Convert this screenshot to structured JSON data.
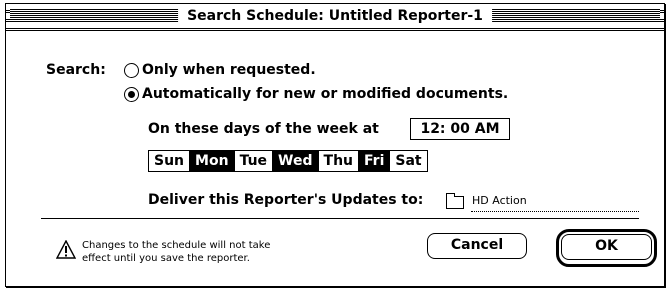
{
  "window": {
    "title": "Search Schedule: Untitled Reporter-1"
  },
  "search": {
    "label": "Search:",
    "option_requested": "Only when requested.",
    "option_automatic": "Automatically for new or modified documents.",
    "selected": "automatic"
  },
  "schedule": {
    "days_label": "On these days of the week at",
    "time": "12: 00  AM",
    "days": [
      {
        "label": "Sun",
        "selected": false
      },
      {
        "label": "Mon",
        "selected": true
      },
      {
        "label": "Tue",
        "selected": false
      },
      {
        "label": "Wed",
        "selected": true
      },
      {
        "label": "Thu",
        "selected": false
      },
      {
        "label": "Fri",
        "selected": true
      },
      {
        "label": "Sat",
        "selected": false
      }
    ]
  },
  "deliver": {
    "label": "Deliver this Reporter's Updates to:",
    "folder": "HD Action"
  },
  "warning": {
    "line1": "Changes to the schedule will not take",
    "line2": "effect until you save the reporter."
  },
  "buttons": {
    "cancel": "Cancel",
    "ok": "OK"
  }
}
